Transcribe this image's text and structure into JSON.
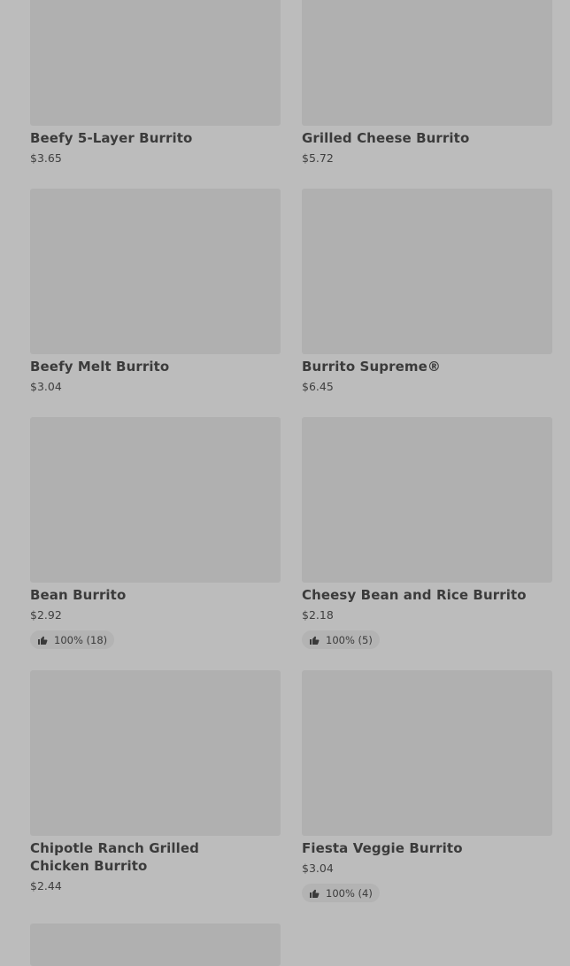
{
  "products": [
    {
      "name": "Beefy 5-Layer Burrito",
      "price": "$3.65",
      "rating": ""
    },
    {
      "name": "Grilled Cheese Burrito",
      "price": "$5.72",
      "rating": ""
    },
    {
      "name": "Beefy Melt Burrito",
      "price": "$3.04",
      "rating": ""
    },
    {
      "name": "Burrito Supreme®",
      "price": "$6.45",
      "rating": ""
    },
    {
      "name": "Bean Burrito",
      "price": "$2.92",
      "rating": "100% (18)"
    },
    {
      "name": "Cheesy Bean and Rice Burrito",
      "price": "$2.18",
      "rating": "100% (5)"
    },
    {
      "name": "Chipotle Ranch Grilled Chicken Burrito",
      "price": "$2.44",
      "rating": ""
    },
    {
      "name": "Fiesta Veggie Burrito",
      "price": "$3.04",
      "rating": "100% (4)"
    }
  ],
  "icons": {
    "rating": "thumbs-up-icon"
  },
  "colors": {
    "background": "#bcbcbc",
    "image_placeholder": "#b0b0b0",
    "text": "#3a3a3a"
  }
}
